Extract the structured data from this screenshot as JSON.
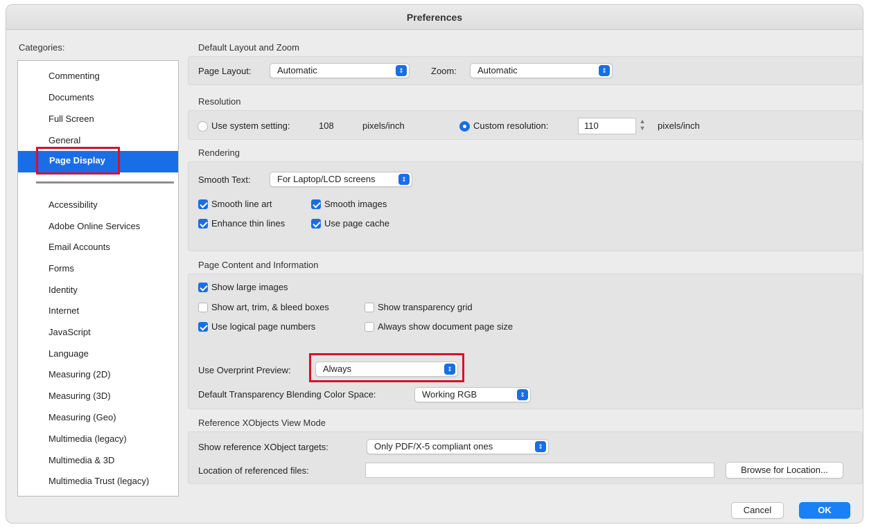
{
  "window": {
    "title": "Preferences"
  },
  "categories": {
    "label": "Categories:",
    "top": [
      "Commenting",
      "Documents",
      "Full Screen",
      "General"
    ],
    "selected": "Page Display",
    "bottom": [
      "Accessibility",
      "Adobe Online Services",
      "Email Accounts",
      "Forms",
      "Identity",
      "Internet",
      "JavaScript",
      "Language",
      "Measuring (2D)",
      "Measuring (3D)",
      "Measuring (Geo)",
      "Multimedia (legacy)",
      "Multimedia & 3D",
      "Multimedia Trust (legacy)"
    ]
  },
  "layout_zoom": {
    "title": "Default Layout and Zoom",
    "page_layout_label": "Page Layout:",
    "page_layout_value": "Automatic",
    "zoom_label": "Zoom:",
    "zoom_value": "Automatic"
  },
  "resolution": {
    "title": "Resolution",
    "system_label": "Use system setting:",
    "system_value": "108",
    "system_unit": "pixels/inch",
    "custom_label": "Custom resolution:",
    "custom_value": "110",
    "custom_unit": "pixels/inch"
  },
  "rendering": {
    "title": "Rendering",
    "smooth_text_label": "Smooth Text:",
    "smooth_text_value": "For Laptop/LCD screens",
    "smooth_line_art": "Smooth line art",
    "smooth_images": "Smooth images",
    "enhance_thin_lines": "Enhance thin lines",
    "use_page_cache": "Use page cache"
  },
  "page_content": {
    "title": "Page Content and Information",
    "show_large_images": "Show large images",
    "show_art_trim": "Show art, trim, & bleed boxes",
    "show_transparency_grid": "Show transparency grid",
    "use_logical_page_numbers": "Use logical page numbers",
    "always_show_page_size": "Always show document page size",
    "overprint_label": "Use Overprint Preview:",
    "overprint_value": "Always",
    "blend_label": "Default Transparency Blending Color Space:",
    "blend_value": "Working RGB"
  },
  "xobjects": {
    "title": "Reference XObjects View Mode",
    "targets_label": "Show reference XObject targets:",
    "targets_value": "Only PDF/X-5 compliant ones",
    "location_label": "Location of referenced files:",
    "location_value": "",
    "browse_label": "Browse for Location..."
  },
  "footer": {
    "cancel_label": "Cancel",
    "ok_label": "OK"
  },
  "colors": {
    "accent": "#1a6ee5",
    "highlight": "#d8102a"
  }
}
